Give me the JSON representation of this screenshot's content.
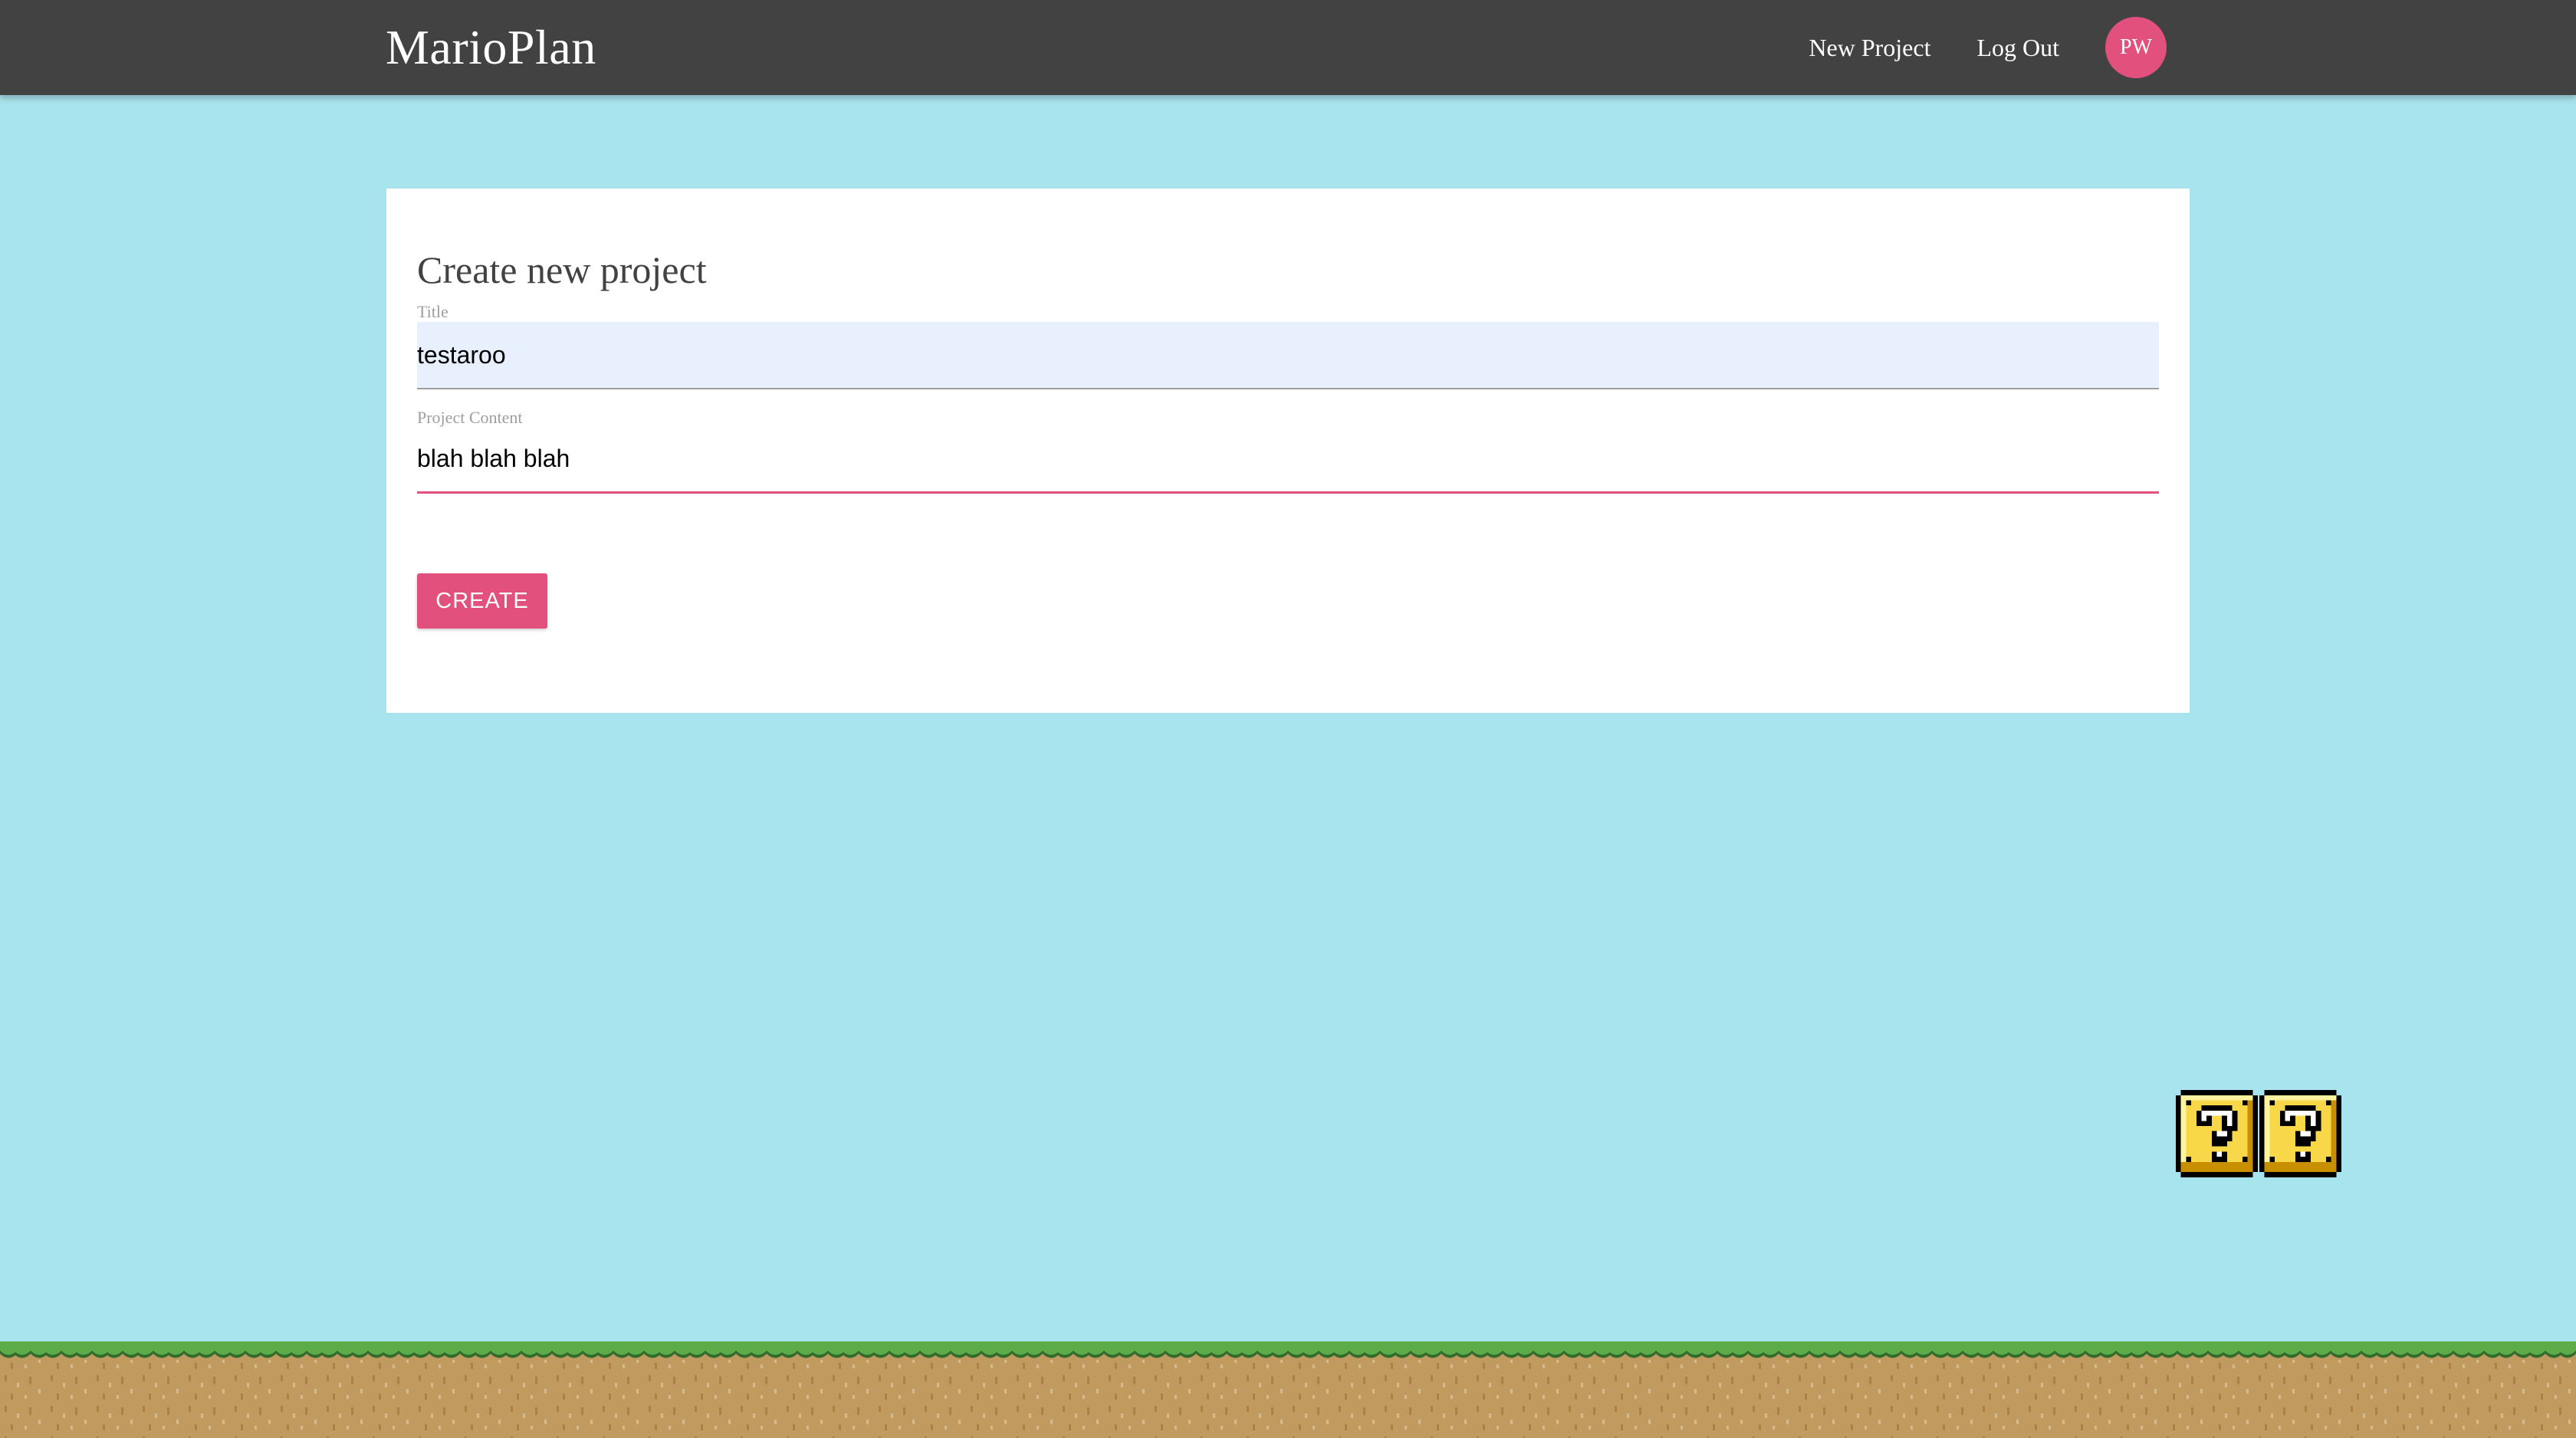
{
  "header": {
    "brand": "MarioPlan",
    "links": [
      "New Project",
      "Log Out"
    ],
    "avatar_initials": "PW"
  },
  "form": {
    "heading": "Create new project",
    "title_label": "Title",
    "title_value": "testaroo",
    "content_label": "Project Content",
    "content_value": "blah blah blah",
    "submit_label": "CREATE"
  },
  "colors": {
    "navbar": "#424242",
    "sky": "#a8e4ee",
    "accent": "#e2507d",
    "autofill": "#e8f0fe",
    "grass": "#5cad4a",
    "dirt": "#c09a5e"
  },
  "decor": {
    "question_block_icon": "question-block-icon",
    "ground_icon": "grass-ground"
  }
}
